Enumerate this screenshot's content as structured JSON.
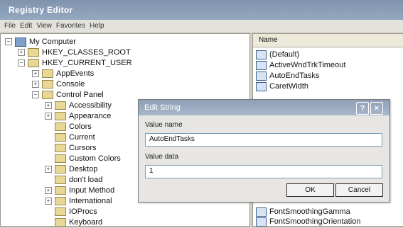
{
  "window": {
    "title": "Registry Editor"
  },
  "menu": [
    "File",
    "Edit",
    "View",
    "Favorites",
    "Help"
  ],
  "tree": {
    "items": [
      {
        "label": "My Computer",
        "toggle": "−",
        "icon": "computer-icon"
      },
      {
        "label": "HKEY_CLASSES_ROOT",
        "toggle": "+",
        "icon": "folder-icon"
      },
      {
        "label": "HKEY_CURRENT_USER",
        "toggle": "−",
        "icon": "folder-icon"
      },
      {
        "label": "AppEvents",
        "toggle": "+",
        "icon": "folder-icon"
      },
      {
        "label": "Console",
        "toggle": "+",
        "icon": "folder-icon"
      },
      {
        "label": "Control Panel",
        "toggle": "−",
        "icon": "folder-icon"
      },
      {
        "label": "Accessibility",
        "toggle": "+",
        "icon": "folder-icon"
      },
      {
        "label": "Appearance",
        "toggle": "+",
        "icon": "folder-icon"
      },
      {
        "label": "Colors",
        "toggle": "",
        "icon": "folder-icon"
      },
      {
        "label": "Current",
        "toggle": "",
        "icon": "folder-icon"
      },
      {
        "label": "Cursors",
        "toggle": "",
        "icon": "folder-icon"
      },
      {
        "label": "Custom Colors",
        "toggle": "",
        "icon": "folder-icon"
      },
      {
        "label": "Desktop",
        "toggle": "+",
        "icon": "folder-icon"
      },
      {
        "label": "don't load",
        "toggle": "",
        "icon": "folder-icon"
      },
      {
        "label": "Input Method",
        "toggle": "+",
        "icon": "folder-icon"
      },
      {
        "label": "International",
        "toggle": "+",
        "icon": "folder-icon"
      },
      {
        "label": "IOProcs",
        "toggle": "",
        "icon": "folder-icon"
      },
      {
        "label": "Keyboard",
        "toggle": "",
        "icon": "folder-icon"
      }
    ]
  },
  "list": {
    "header": "Name",
    "items": [
      "(Default)",
      "ActiveWndTrkTimeout",
      "AutoEndTasks",
      "CaretWidth",
      "FontSmoothingGamma",
      "FontSmoothingOrientation"
    ]
  },
  "dialog": {
    "title": "Edit String",
    "help": "?",
    "close": "×",
    "value_name_label": "Value name",
    "value_name": "AutoEndTasks",
    "value_data_label": "Value data",
    "value_data": "1",
    "ok": "OK",
    "cancel": "Cancel"
  }
}
